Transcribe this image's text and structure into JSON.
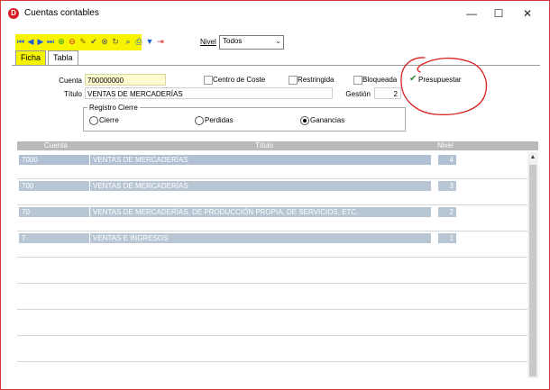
{
  "window": {
    "title": "Cuentas contables",
    "minimize": "—",
    "maximize": "☐",
    "close": "✕"
  },
  "toolbar": {
    "icons": [
      "first-icon",
      "prev-icon",
      "next-icon",
      "last-icon",
      "add-icon",
      "delete-icon",
      "edit-icon",
      "confirm-icon",
      "cancel-icon",
      "refresh-icon",
      "search-icon",
      "print-icon",
      "filter-icon",
      "exit-icon"
    ],
    "nivel_label": "Nivel",
    "nivel_value": "Todos"
  },
  "tabs": [
    {
      "label": "Ficha",
      "active": true
    },
    {
      "label": "Tabla",
      "active": false
    }
  ],
  "form": {
    "cuenta_label": "Cuenta",
    "cuenta_value": "700000000",
    "centro_coste_label": "Centro de Coste",
    "restringida_label": "Restringida",
    "bloqueada_label": "Bloqueada",
    "presupuestar_label": "Presupuestar",
    "presupuestar_checked": true,
    "titulo_label": "Título",
    "titulo_value": "VENTAS DE MERCADERÍAS",
    "gestion_label": "Gestión",
    "gestion_value": "2",
    "registro_cierre_label": "Registro Cierre",
    "radio_cierre": "Cierre",
    "radio_perdidas": "Perdidas",
    "radio_ganancias": "Ganancias",
    "selected_radio": "Ganancias"
  },
  "grid": {
    "columns": [
      "Cuenta",
      "Título",
      "Nivel"
    ],
    "rows": [
      {
        "cuenta": "7000",
        "titulo": "VENTAS DE MERCADERÍAS",
        "nivel": "4",
        "selected": true
      },
      {
        "cuenta": "700",
        "titulo": "VENTAS DE MERCADERÍAS",
        "nivel": "3",
        "selected": false
      },
      {
        "cuenta": "70",
        "titulo": "VENTAS DE MERCADERÍAS, DE PRODUCCIÓN PROPIA, DE SERVICIOS, ETC.",
        "nivel": "2",
        "selected": false
      },
      {
        "cuenta": "7",
        "titulo": "VENTAS E INGRESOS",
        "nivel": "1",
        "selected": false
      }
    ]
  },
  "colors": {
    "toolbar_bg": "#f8f400",
    "row_fill": "#b8c6d4",
    "header_fill": "#b9b9b9",
    "annotation": "#d92020"
  }
}
